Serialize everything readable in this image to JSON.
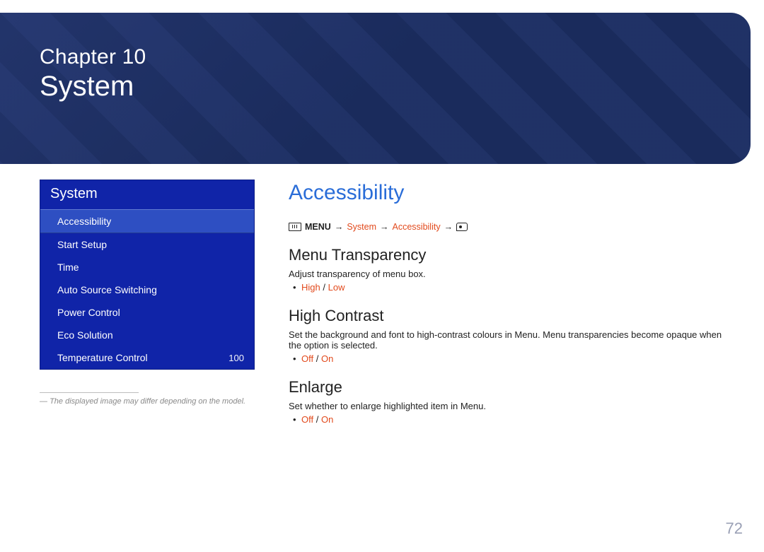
{
  "header": {
    "chapter": "Chapter 10",
    "title": "System"
  },
  "sidebar": {
    "title": "System",
    "items": [
      {
        "label": "Accessibility",
        "value": null,
        "selected": true
      },
      {
        "label": "Start Setup",
        "value": null,
        "selected": false
      },
      {
        "label": "Time",
        "value": null,
        "selected": false
      },
      {
        "label": "Auto Source Switching",
        "value": null,
        "selected": false
      },
      {
        "label": "Power Control",
        "value": null,
        "selected": false
      },
      {
        "label": "Eco Solution",
        "value": null,
        "selected": false
      },
      {
        "label": "Temperature Control",
        "value": "100",
        "selected": false
      }
    ],
    "note_prefix": "―  ",
    "note": "The displayed image may differ depending on the model."
  },
  "content": {
    "title": "Accessibility",
    "breadcrumb": {
      "icon_text": "III",
      "menu_label": "MENU",
      "arrow": "→",
      "seg1": "System",
      "seg2": "Accessibility"
    },
    "sections": [
      {
        "heading": "Menu Transparency",
        "body": "Adjust transparency of menu box.",
        "options": [
          "High",
          "Low"
        ]
      },
      {
        "heading": "High Contrast",
        "body": "Set the background and font to high-contrast colours in Menu. Menu transparencies become opaque when the option is selected.",
        "options": [
          "Off",
          "On"
        ]
      },
      {
        "heading": "Enlarge",
        "body": "Set whether to enlarge highlighted item in Menu.",
        "options": [
          "Off",
          "On"
        ]
      }
    ]
  },
  "page_number": "72"
}
